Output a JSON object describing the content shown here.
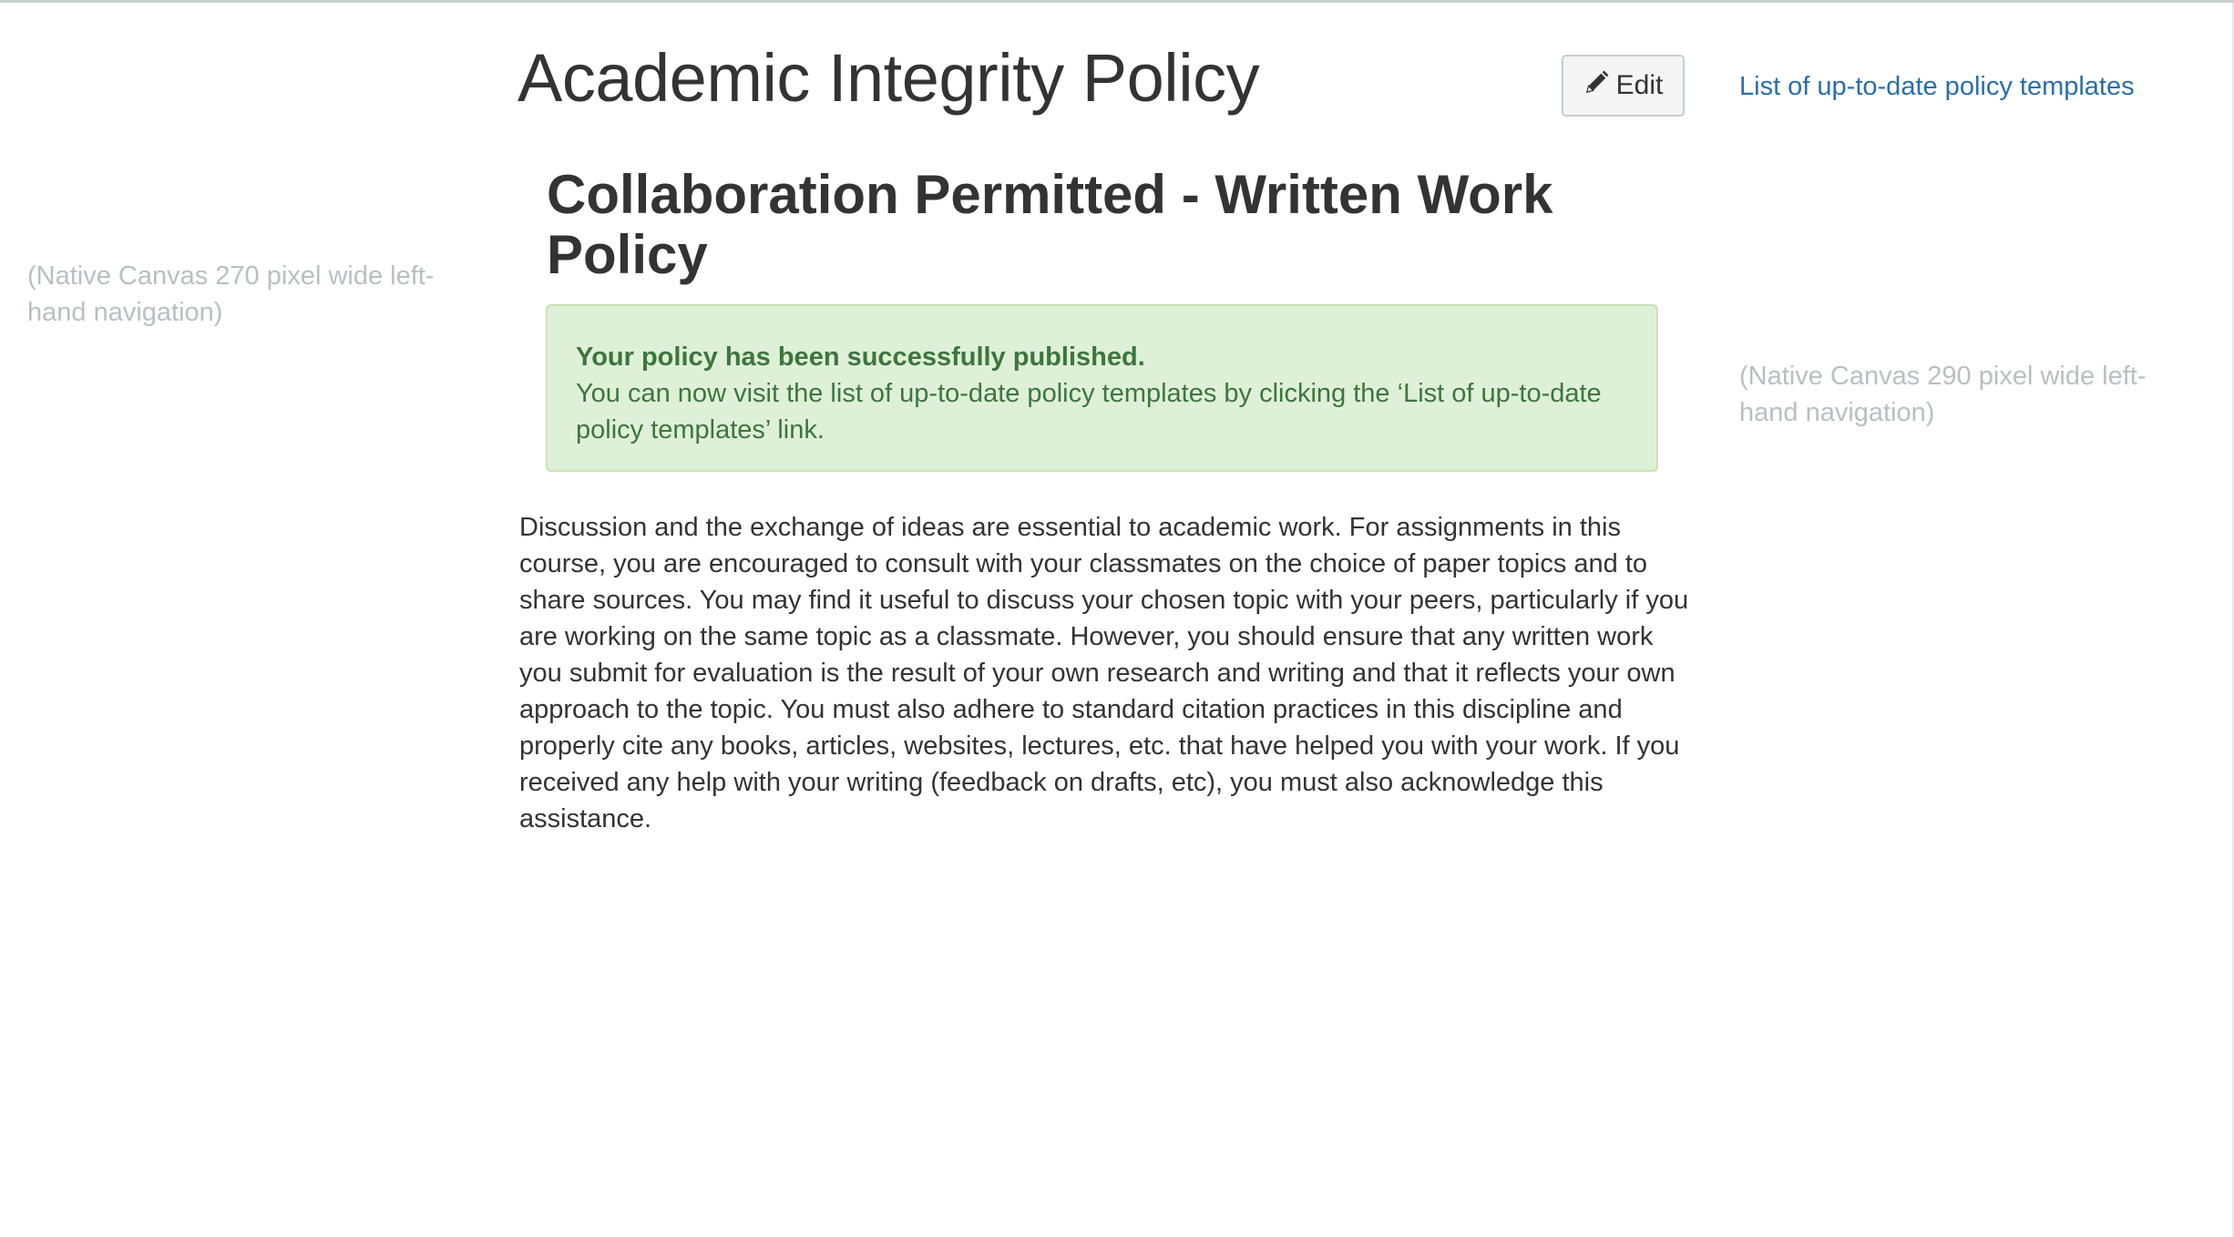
{
  "page": {
    "title": "Academic Integrity Policy"
  },
  "toolbar": {
    "edit_label": "Edit",
    "templates_link": "List of up-to-date policy templates"
  },
  "notes": {
    "left_nav": "(Native Canvas 270 pixel wide left-hand navigation)",
    "right_nav": "(Native Canvas 290 pixel wide left-hand navigation)"
  },
  "policy": {
    "title": "Collaboration Permitted - Written Work Policy",
    "body": "Discussion and the exchange of ideas are essential to academic work. For assignments in this course, you are encouraged to consult with your classmates on the choice of paper topics and to share sources. You may find it useful to discuss your chosen topic with your peers, particularly if you are working on the same topic as a classmate. However, you should ensure that any written work you submit for evaluation is the result of your own research and writing and that it reflects your own approach to the topic. You must also adhere to standard citation practices in this discipline and properly cite any books, articles, websites, lectures, etc. that have helped you with your work. If you received any help with your writing (feedback on drafts, etc), you must also acknowledge this assistance."
  },
  "alert": {
    "heading": "Your policy has been successfully published.",
    "message": "You can now visit the list of up-to-date policy templates by clicking the ‘List of up-to-date policy templates’ link."
  },
  "icons": {
    "edit": "pencil-icon"
  },
  "colors": {
    "link": "#2a6fa9",
    "alert_bg": "#dff0d8",
    "alert_text": "#3c763d",
    "note_text": "#b9bfc3"
  }
}
